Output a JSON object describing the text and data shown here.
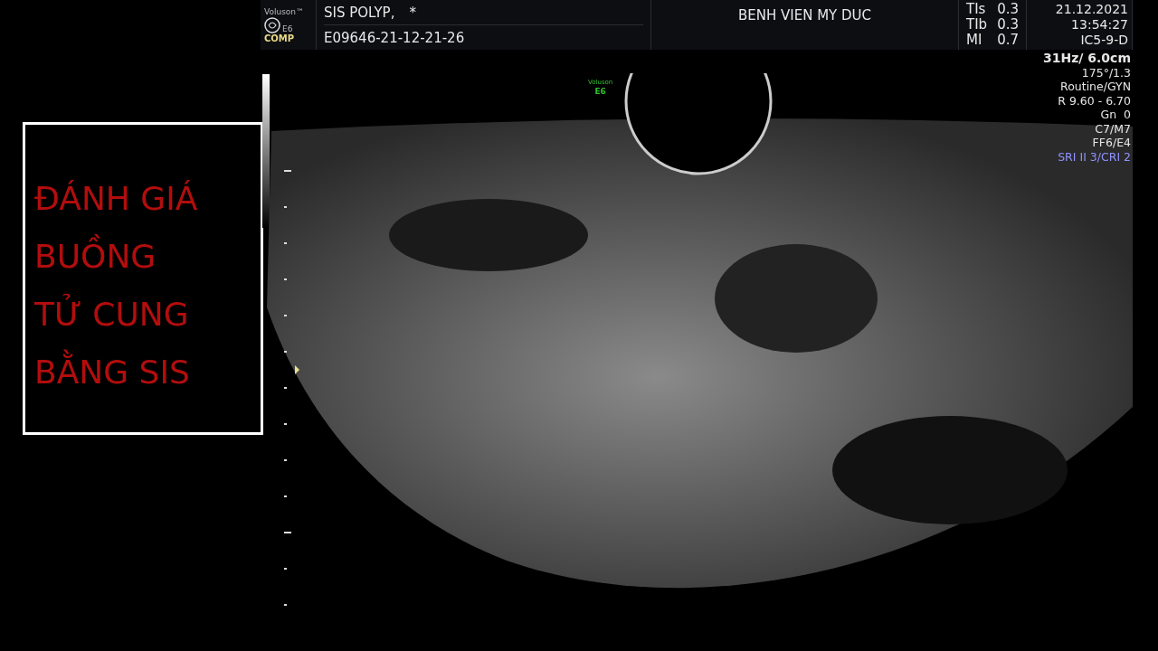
{
  "header": {
    "brand": "Voluson™",
    "model": "E6",
    "comp": "COMP",
    "patient": "SIS POLYP,",
    "flag": "*",
    "exam_id": "E09646-21-12-21-26",
    "hospital": "BENH VIEN MY DUC",
    "indices": [
      {
        "label": "TIs",
        "value": "0.3"
      },
      {
        "label": "TIb",
        "value": "0.3"
      },
      {
        "label": "MI",
        "value": "0.7"
      }
    ],
    "date": "21.12.2021",
    "time": "13:54:27",
    "probe": "IC5-9-D"
  },
  "params": [
    {
      "text": "31Hz/ 6.0cm",
      "kind": "large"
    },
    {
      "text": "175°/1.3",
      "kind": "normal"
    },
    {
      "text": "Routine/GYN",
      "kind": "normal"
    },
    {
      "text": "R 9.60 - 6.70",
      "kind": "normal"
    },
    {
      "text": "Gn  0",
      "kind": "normal"
    },
    {
      "text": "C7/M7",
      "kind": "normal"
    },
    {
      "text": "FF6/E4",
      "kind": "normal"
    },
    {
      "text": "SRI II 3/CRI 2",
      "kind": "highlight"
    }
  ],
  "image_logo": {
    "brand": "Voluson",
    "model": "E6"
  },
  "title_box": {
    "lines": [
      "ĐÁNH GIÁ",
      "BUỒNG",
      "TỬ CUNG",
      "BẰNG SIS"
    ]
  }
}
